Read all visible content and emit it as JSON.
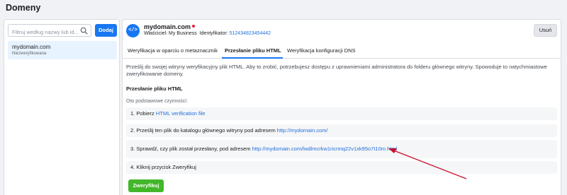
{
  "page": {
    "title": "Domeny"
  },
  "sidebar": {
    "search_placeholder": "Filtruj według nazwy lub id...",
    "add_label": "Dodaj",
    "domains": [
      {
        "name": "mydomain.com",
        "status": "Niezweryfikowana"
      }
    ]
  },
  "domain": {
    "avatar": "</>",
    "name": "mydomain.com",
    "owner_label": "Właściciel:",
    "owner": "My Business",
    "id_label": "Identyfikator:",
    "id": "512434823454442",
    "delete_label": "Usuń"
  },
  "tabs": [
    {
      "label": "Weryfikacja w oparciu o metaznacznik",
      "active": false
    },
    {
      "label": "Przesłanie pliku HTML",
      "active": true
    },
    {
      "label": "Weryfikacja konfiguracji DNS",
      "active": false
    }
  ],
  "content": {
    "intro": "Prześlij do swojej witryny weryfikacyjny plik HTML. Aby to zrobić, potrzebujesz dostępu z uprawnieniami administratora do folderu głównego witryny. Spowoduje to natychmiastowe zweryfikowanie domeny.",
    "heading": "Przesłanie pliku HTML",
    "steps_caption": "Oto podstawowe czynności:",
    "steps": [
      {
        "text": "1. Pobierz ",
        "link": "HTML verification file"
      },
      {
        "text": "2. Prześlij ten plik do katalogu głównego witryny pod adresem ",
        "link": "http://mydomain.com/"
      },
      {
        "text": "3. Sprawdź, czy plik został przesłany, pod adresem ",
        "link": "http://mydomain.com/lwdlmcrkw1ricrmq22v1xk95o7t10m.html"
      },
      {
        "text": "4. Kliknij przycisk Zweryfikuj",
        "link": ""
      }
    ],
    "verify_label": "Zweryfikuj"
  },
  "colors": {
    "accent": "#1877f2",
    "verify": "#42b72a",
    "annotation_arrow": "#c8102e",
    "status_dot": "#e41e3f"
  }
}
